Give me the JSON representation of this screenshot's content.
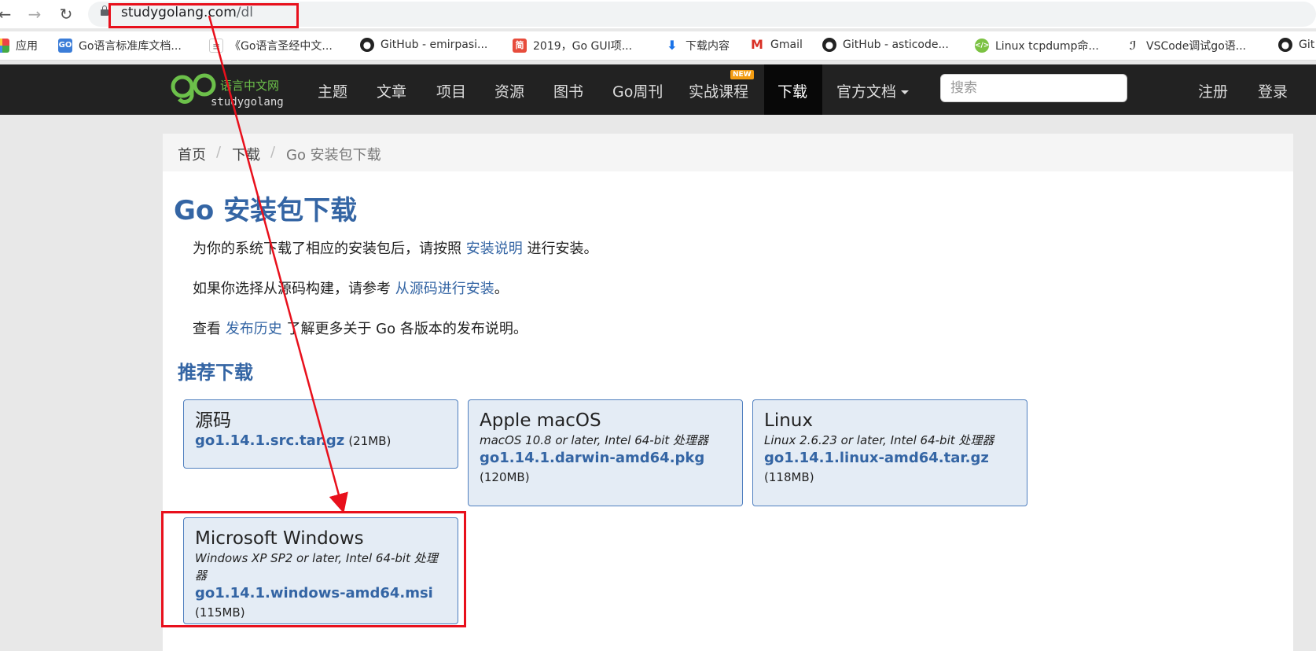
{
  "browser": {
    "url_host": "studygolang.com",
    "url_path": "/dl",
    "bookmarks": [
      {
        "label": "应用",
        "icon": "apps-grid-icon"
      },
      {
        "label": "Go语言标准库文档...",
        "icon": "go-icon"
      },
      {
        "label": "《Go语言圣经中文...",
        "icon": "book-icon"
      },
      {
        "label": "GitHub - emirpasi...",
        "icon": "github-icon"
      },
      {
        "label": "2019，Go GUI项...",
        "icon": "jian-icon"
      },
      {
        "label": "下载内容",
        "icon": "download-icon"
      },
      {
        "label": "Gmail",
        "icon": "gmail-icon"
      },
      {
        "label": "GitHub - asticode...",
        "icon": "github-icon"
      },
      {
        "label": "Linux tcpdump命...",
        "icon": "code-icon"
      },
      {
        "label": "VSCode调试go语...",
        "icon": "vscode-icon"
      },
      {
        "label": "Git",
        "icon": "github-icon"
      }
    ]
  },
  "site": {
    "logo_cn": "语言中文网",
    "logo_en": "studygolang",
    "nav": [
      "主题",
      "文章",
      "项目",
      "资源",
      "图书",
      "Go周刊",
      "实战课程",
      "下载",
      "官方文档"
    ],
    "new_badge": "NEW",
    "search_placeholder": "搜索",
    "register": "注册",
    "login": "登录"
  },
  "breadcrumb": [
    "首页",
    "下载",
    "Go 安装包下载"
  ],
  "page": {
    "title": "Go 安装包下载",
    "p1_before": "为你的系统下载了相应的安装包后，请按照 ",
    "p1_link": "安装说明",
    "p1_after": " 进行安装。",
    "p2_before": "如果你选择从源码构建，请参考 ",
    "p2_link": "从源码进行安装",
    "p2_after": "。",
    "p3_before": "查看 ",
    "p3_link": "发布历史",
    "p3_after": " 了解更多关于 Go 各版本的发布说明。",
    "section": "推荐下载"
  },
  "downloads": [
    {
      "title": "源码",
      "req": "",
      "file": "go1.14.1.src.tar.gz",
      "size": "(21MB)"
    },
    {
      "title": "Apple macOS",
      "req": "macOS 10.8 or later, Intel 64-bit 处理器",
      "file": "go1.14.1.darwin-amd64.pkg",
      "size": "(120MB)"
    },
    {
      "title": "Linux",
      "req": "Linux 2.6.23 or later, Intel 64-bit 处理器",
      "file": "go1.14.1.linux-amd64.tar.gz",
      "size": "(118MB)"
    },
    {
      "title": "Microsoft Windows",
      "req": "Windows XP SP2 or later, Intel 64-bit 处理器",
      "file": "go1.14.1.windows-amd64.msi",
      "size": "(115MB)"
    }
  ],
  "colors": {
    "accent": "#3465a4",
    "annotation": "#e8101c",
    "navbar": "#222222",
    "card_bg": "#e4ecf5"
  }
}
